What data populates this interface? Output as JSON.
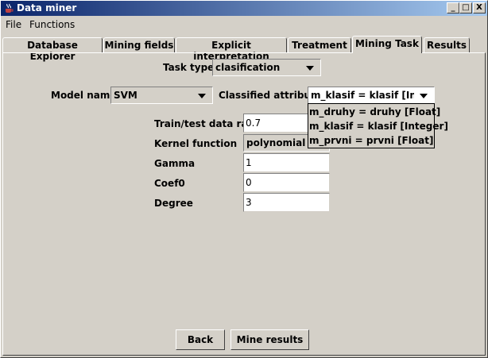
{
  "window": {
    "title": "Data miner"
  },
  "titlebar_buttons": {
    "minimize": "_",
    "maximize": "□",
    "close": "X"
  },
  "menu": {
    "file": "File",
    "functions": "Functions"
  },
  "tabs": [
    {
      "label": "Database Explorer"
    },
    {
      "label": "Mining fields"
    },
    {
      "label": "Explicit interpretation"
    },
    {
      "label": "Treatment"
    },
    {
      "label": "Mining Task",
      "active": true
    },
    {
      "label": "Results"
    }
  ],
  "task": {
    "label": "Task type",
    "value": "clasification"
  },
  "model": {
    "label": "Model name",
    "value": "SVM"
  },
  "classified": {
    "label": "Classified attribute",
    "value": "m_klasif = klasif [Inte...",
    "options": [
      "m_druhy = druhy [Float]",
      "m_klasif = klasif [Integer]",
      "m_prvni = prvni [Float]"
    ]
  },
  "params": {
    "ratio_label": "Train/test data ratio",
    "ratio_value": "0.7",
    "kernel_label": "Kernel function",
    "kernel_value": "polynomial",
    "gamma_label": "Gamma",
    "gamma_value": "1",
    "coef0_label": "Coef0",
    "coef0_value": "0",
    "degree_label": "Degree",
    "degree_value": "3"
  },
  "buttons": {
    "back": "Back",
    "mine": "Mine results"
  }
}
